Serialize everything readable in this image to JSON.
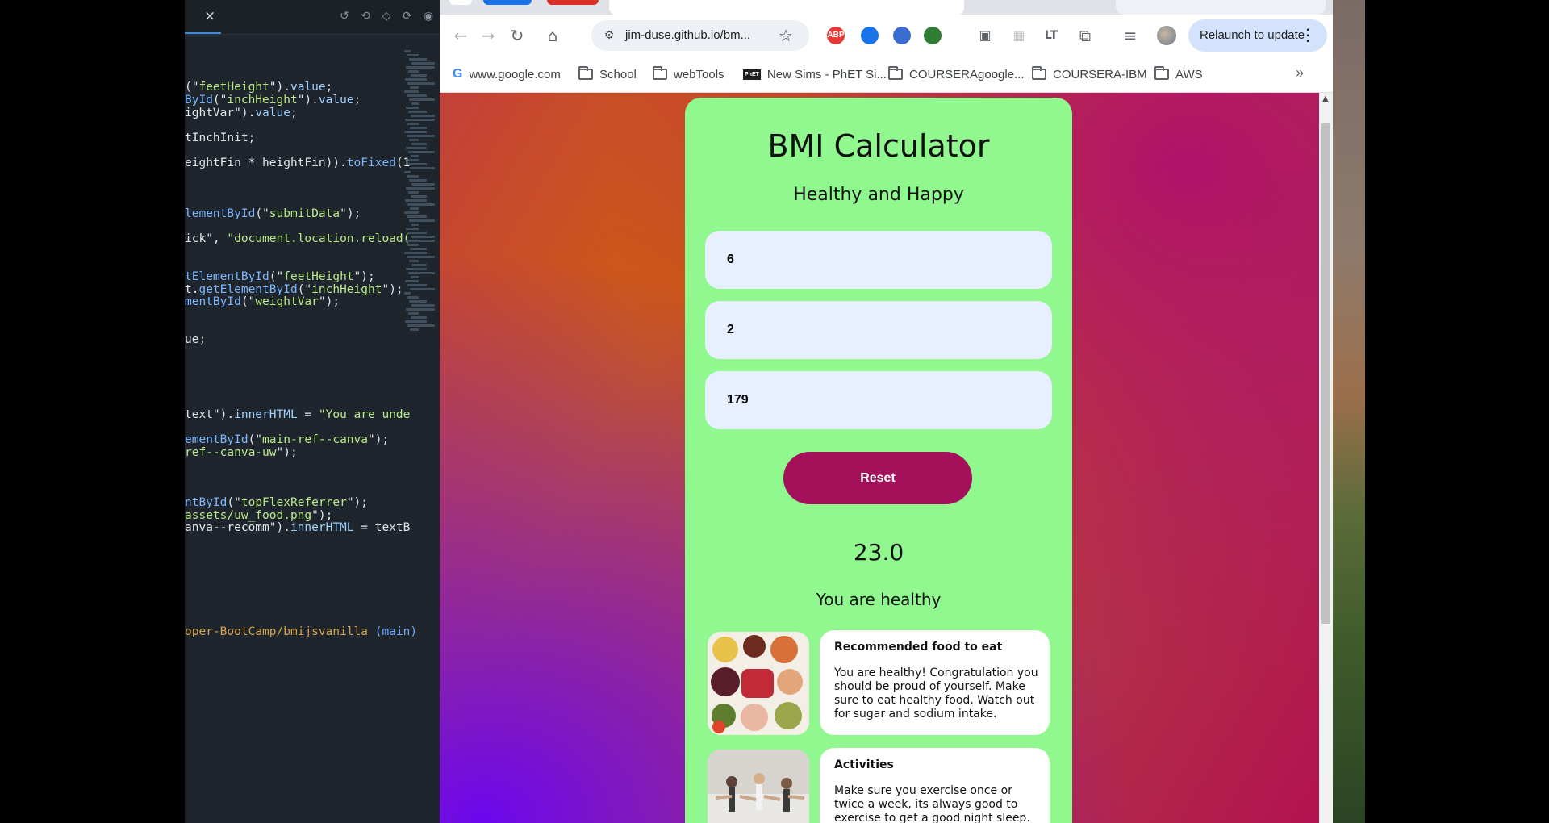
{
  "editor": {
    "close_glyph": "×",
    "code_lines": [
      {
        "parts": [
          [
            "op",
            "(\""
          ],
          [
            "str",
            "feetHeight"
          ],
          [
            "op",
            "\")."
          ],
          [
            "prop",
            "value"
          ],
          [
            "op",
            ";"
          ]
        ]
      },
      {
        "parts": [
          [
            "fn",
            "ById"
          ],
          [
            "op",
            "(\""
          ],
          [
            "str",
            "inchHeight"
          ],
          [
            "op",
            "\")."
          ],
          [
            "prop",
            "value"
          ],
          [
            "op",
            ";"
          ]
        ]
      },
      {
        "parts": [
          [
            "op",
            "ightVar\")."
          ],
          [
            "prop",
            "value"
          ],
          [
            "op",
            ";"
          ]
        ]
      },
      {
        "parts": [
          [
            "op",
            "tInchInit;"
          ]
        ]
      },
      {
        "parts": [
          [
            "op",
            "eightFin * heightFin))."
          ],
          [
            "fn",
            "toFixed"
          ],
          [
            "op",
            "(1"
          ]
        ]
      },
      {
        "parts": [
          [
            "fn",
            "lementById"
          ],
          [
            "op",
            "(\""
          ],
          [
            "str",
            "submitData"
          ],
          [
            "op",
            "\");"
          ]
        ]
      },
      {
        "parts": [
          [
            "op",
            "ick\", "
          ],
          [
            "str",
            "\"document.location.reload("
          ]
        ]
      },
      {
        "parts": [
          [
            "fn",
            "tElementById"
          ],
          [
            "op",
            "(\""
          ],
          [
            "str",
            "feetHeight"
          ],
          [
            "op",
            "\");"
          ]
        ]
      },
      {
        "parts": [
          [
            "op",
            "t."
          ],
          [
            "fn",
            "getElementById"
          ],
          [
            "op",
            "(\""
          ],
          [
            "str",
            "inchHeight"
          ],
          [
            "op",
            "\");"
          ]
        ]
      },
      {
        "parts": [
          [
            "fn",
            "mentById"
          ],
          [
            "op",
            "(\""
          ],
          [
            "str",
            "weightVar"
          ],
          [
            "op",
            "\");"
          ]
        ]
      },
      {
        "parts": [
          [
            "op",
            "ue;"
          ]
        ]
      },
      {
        "parts": [
          [
            "op",
            "text\")."
          ],
          [
            "prop",
            "innerHTML"
          ],
          [
            "op",
            " = "
          ],
          [
            "str",
            "\"You are unde"
          ]
        ]
      },
      {
        "parts": [
          [
            "fn",
            "ementById"
          ],
          [
            "op",
            "(\""
          ],
          [
            "str",
            "main-ref--canva"
          ],
          [
            "op",
            "\");"
          ]
        ]
      },
      {
        "parts": [
          [
            "str",
            "ref--canva-uw"
          ],
          [
            "op",
            "\");"
          ]
        ]
      },
      {
        "parts": [
          [
            "fn",
            "ntById"
          ],
          [
            "op",
            "(\""
          ],
          [
            "str",
            "topFlexReferrer"
          ],
          [
            "op",
            "\");"
          ]
        ]
      },
      {
        "parts": [
          [
            "str",
            "assets/uw_food.png"
          ],
          [
            "op",
            "\");"
          ]
        ]
      },
      {
        "parts": [
          [
            "op",
            "anva--recomm\")."
          ],
          [
            "prop",
            "innerHTML"
          ],
          [
            "op",
            " = textB"
          ]
        ]
      },
      {
        "parts": [
          [
            "path",
            "oper-BootCamp/bmijsvanilla"
          ],
          [
            "op",
            " "
          ],
          [
            "branch",
            "(main)"
          ]
        ]
      }
    ]
  },
  "browser": {
    "url": "jim-duse.github.io/bm...",
    "relaunch_label": "Relaunch to update",
    "extensions": [
      {
        "name": "adblock-plus-icon",
        "label": "ABP",
        "color": "#e53935"
      },
      {
        "name": "clipboard-extension-icon",
        "label": "",
        "color": "#1a73e8"
      },
      {
        "name": "circle-extension-icon",
        "label": "",
        "color": "#3b6cd1"
      },
      {
        "name": "tree-extension-icon",
        "label": "",
        "color": "#2e7d32"
      }
    ],
    "bookmarks": [
      {
        "name": "bookmark-google",
        "label": "www.google.com",
        "icon": "google-icon"
      },
      {
        "name": "bookmark-school",
        "label": "School",
        "icon": "folder-icon"
      },
      {
        "name": "bookmark-webtools",
        "label": "webTools",
        "icon": "folder-icon"
      },
      {
        "name": "bookmark-phet",
        "label": "New Sims - PhET Si...",
        "icon": "phet-icon"
      },
      {
        "name": "bookmark-coursera-google",
        "label": "COURSERAgoogle...",
        "icon": "folder-icon"
      },
      {
        "name": "bookmark-coursera-ibm",
        "label": "COURSERA-IBM",
        "icon": "folder-icon"
      },
      {
        "name": "bookmark-aws",
        "label": "AWS",
        "icon": "folder-icon"
      }
    ]
  },
  "app": {
    "title": "BMI Calculator",
    "subtitle": "Healthy and Happy",
    "feet_value": "6",
    "inch_value": "2",
    "weight_value": "179",
    "reset_label": "Reset",
    "bmi_value": "23.0",
    "status": "You are healthy",
    "recommendations": [
      {
        "title": "Recommended food to eat",
        "text": "You are healthy! Congratulation you should be proud of yourself. Make sure to eat healthy food. Watch out for sugar and sodium intake."
      },
      {
        "title": "Activities",
        "text": "Make sure you exercise once or twice a week, its always good to exercise to get a good night sleep."
      }
    ]
  },
  "colors": {
    "card_bg": "#90f88f",
    "input_bg": "#e8effe",
    "reset_button": "#a3115a"
  }
}
